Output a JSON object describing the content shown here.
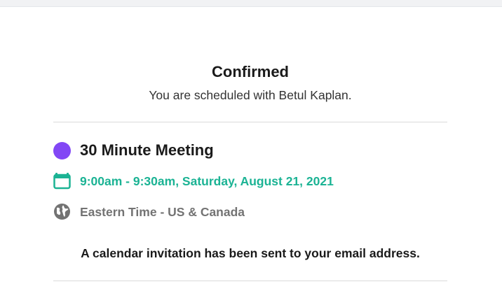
{
  "confirmation": {
    "heading": "Confirmed",
    "subheading": "You are scheduled with Betul Kaplan."
  },
  "event": {
    "title": "30 Minute Meeting",
    "color": "#8247f5",
    "time": "9:00am - 9:30am, Saturday, August 21, 2021",
    "time_color": "#1bb394",
    "timezone": "Eastern Time - US & Canada",
    "timezone_color": "#737373",
    "icons": {
      "event_marker": "purple-dot-icon",
      "time": "calendar-icon",
      "timezone": "globe-icon"
    }
  },
  "notice": "A calendar invitation has been sent to your email address."
}
